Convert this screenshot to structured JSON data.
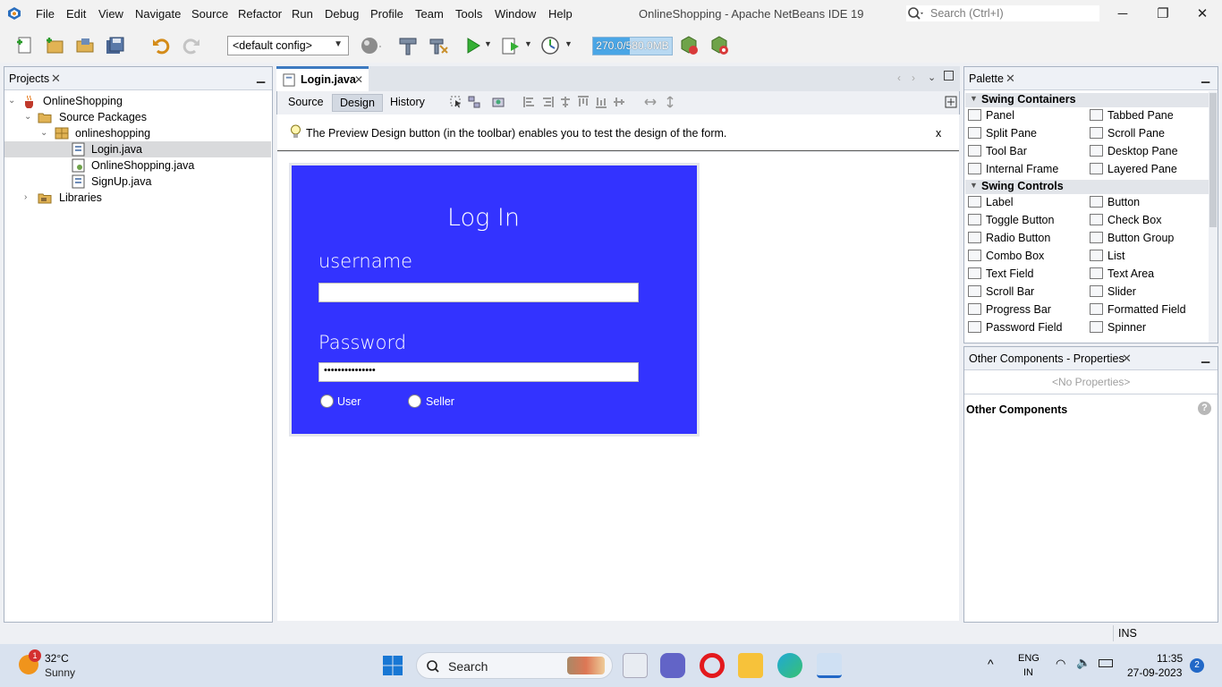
{
  "menu": [
    "File",
    "Edit",
    "View",
    "Navigate",
    "Source",
    "Refactor",
    "Run",
    "Debug",
    "Profile",
    "Team",
    "Tools",
    "Window",
    "Help"
  ],
  "window_title": "OnlineShopping - Apache NetBeans IDE 19",
  "search": {
    "placeholder": "Search (Ctrl+I)"
  },
  "toolbar": {
    "config": "<default config>",
    "memory": "270.0/580.0MB",
    "memory_fraction": 0.47
  },
  "projects": {
    "title": "Projects",
    "tree": [
      {
        "label": "OnlineShopping",
        "level": 0
      },
      {
        "label": "Source Packages",
        "level": 1
      },
      {
        "label": "onlineshopping",
        "level": 2
      },
      {
        "label": "Login.java",
        "level": 3,
        "selected": true
      },
      {
        "label": "OnlineShopping.java",
        "level": 3
      },
      {
        "label": "SignUp.java",
        "level": 3
      },
      {
        "label": "Libraries",
        "level": 1
      }
    ]
  },
  "editor": {
    "tab": "Login.java",
    "subtabs": [
      "Source",
      "Design",
      "History"
    ],
    "active_subtab": "Design",
    "hint": "The Preview Design button (in the toolbar) enables you to test the design of the form.",
    "hint_close": "x"
  },
  "login_form": {
    "title": "Log In",
    "username_label": "username",
    "username_value": "",
    "password_label": "Password",
    "password_value": "•••••••••••••••",
    "radio_user": "User",
    "radio_seller": "Seller",
    "bg_color": "#3333ff"
  },
  "palette": {
    "title": "Palette",
    "swing_containers": {
      "label": "Swing Containers",
      "items": [
        "Panel",
        "Tabbed Pane",
        "Split Pane",
        "Scroll Pane",
        "Tool Bar",
        "Desktop Pane",
        "Internal Frame",
        "Layered Pane"
      ]
    },
    "swing_controls": {
      "label": "Swing Controls",
      "items": [
        "Label",
        "Button",
        "Toggle Button",
        "Check Box",
        "Radio Button",
        "Button Group",
        "Combo Box",
        "List",
        "Text Field",
        "Text Area",
        "Scroll Bar",
        "Slider",
        "Progress Bar",
        "Formatted Field",
        "Password Field",
        "Spinner"
      ]
    }
  },
  "properties": {
    "title": "Other Components - Properties",
    "no_props": "<No Properties>",
    "section": "Other Components"
  },
  "status": {
    "mode": "INS"
  },
  "taskbar": {
    "weather_temp": "32°C",
    "weather_cond": "Sunny",
    "weather_badge": "1",
    "search": "Search",
    "lang1": "ENG",
    "lang2": "IN",
    "time": "11:35",
    "date": "27-09-2023",
    "notifications": "2"
  }
}
